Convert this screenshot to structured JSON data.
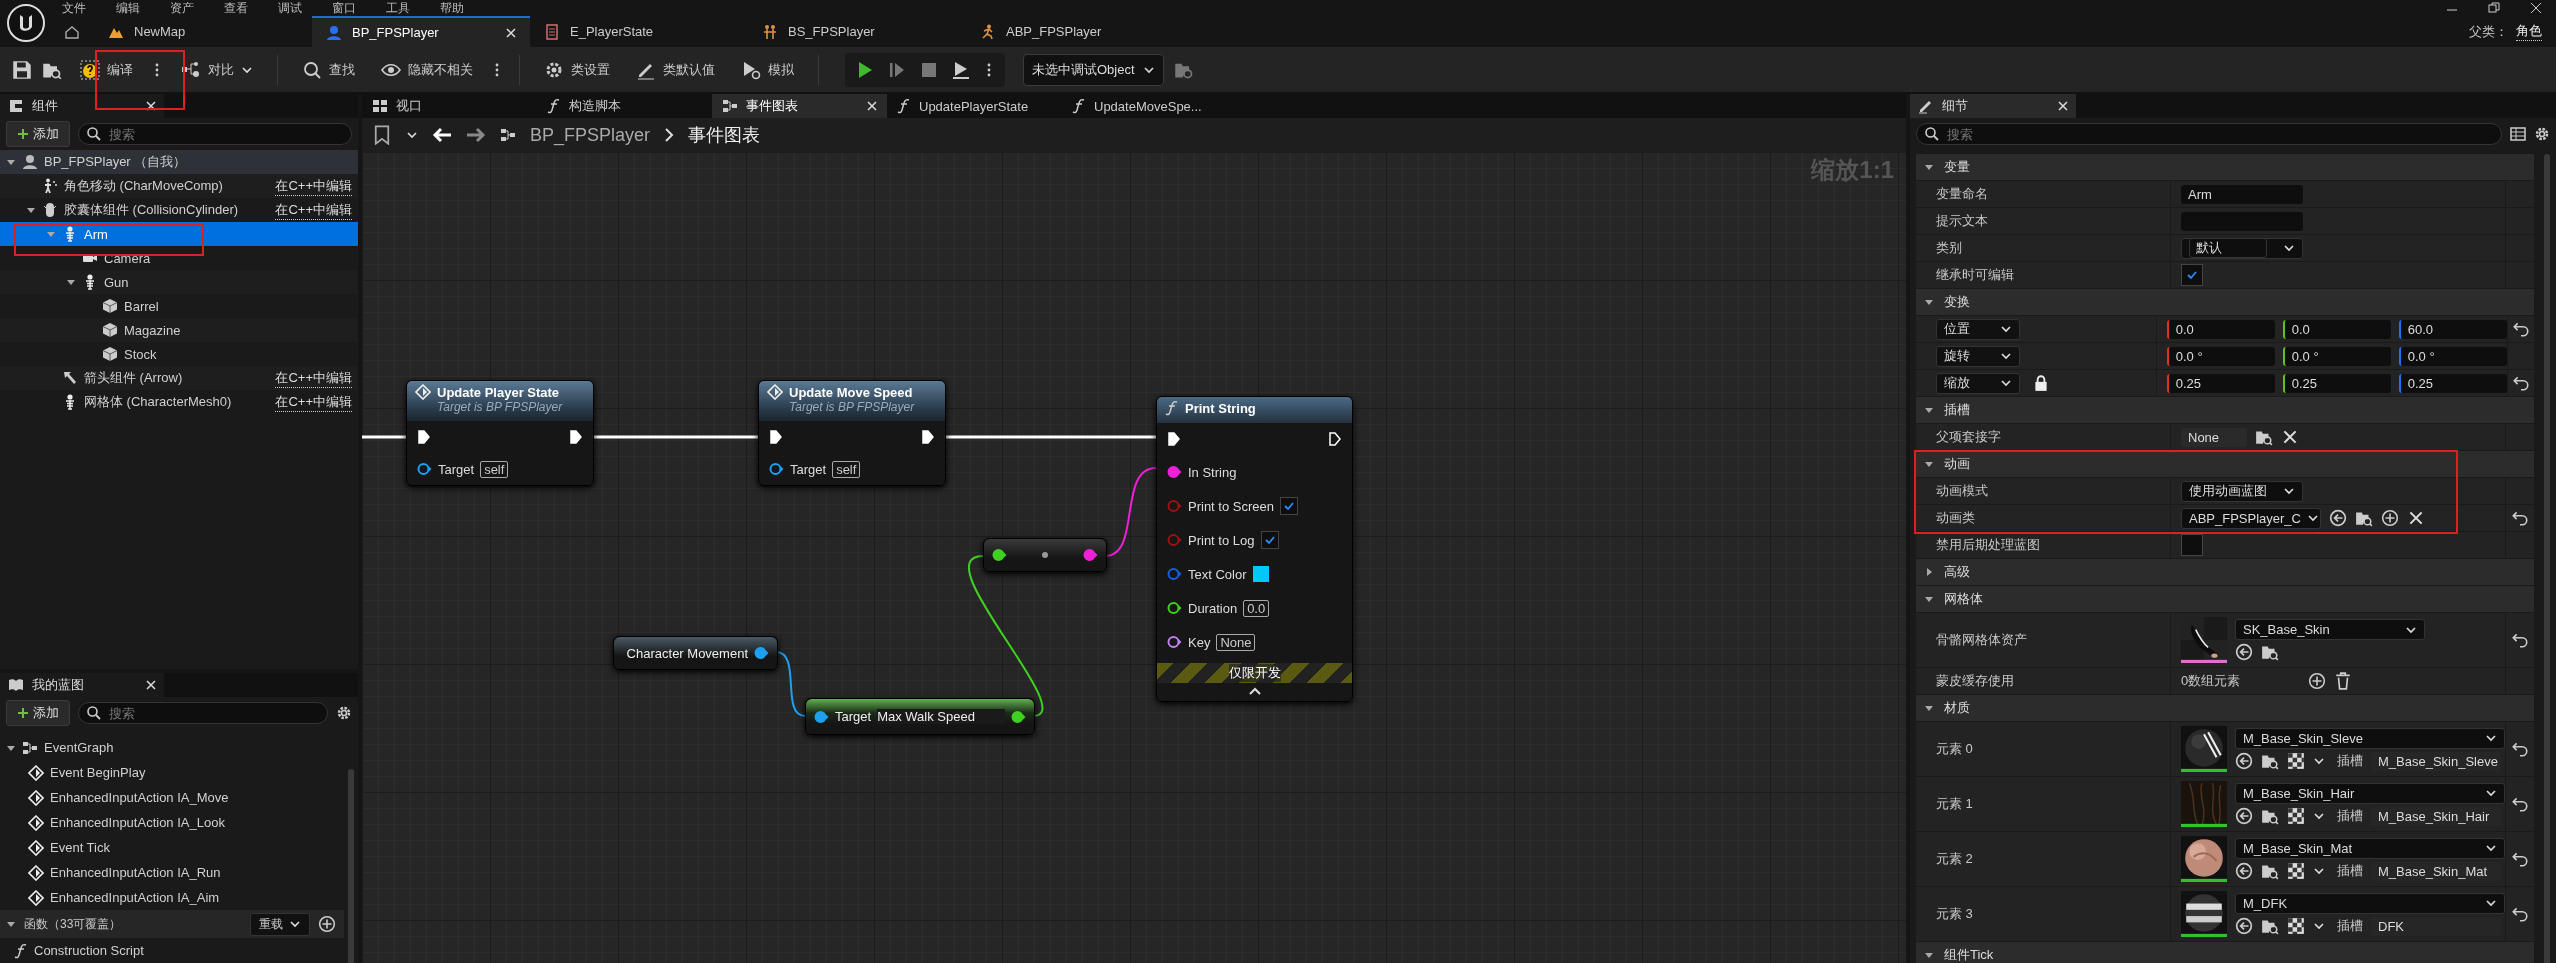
{
  "menu": [
    "文件",
    "编辑",
    "资产",
    "查看",
    "调试",
    "窗口",
    "工具",
    "帮助"
  ],
  "tabs": [
    {
      "kind": "level",
      "label": "NewMap",
      "selected": false
    },
    {
      "kind": "blueprint",
      "label": "BP_FPSPlayer",
      "selected": true
    },
    {
      "kind": "enum",
      "label": "E_PlayerState",
      "selected": false
    },
    {
      "kind": "blend_space",
      "label": "BS_FPSPlayer",
      "selected": false
    },
    {
      "kind": "anim_blueprint",
      "label": "ABP_FPSPlayer",
      "selected": false
    }
  ],
  "parent_class": {
    "label": "父类：",
    "value": "角色"
  },
  "toolbar": {
    "compile": "编译",
    "diff": "对比",
    "find": "查找",
    "hide": "隐藏不相关",
    "class_settings": "类设置",
    "class_defaults": "类默认值",
    "simulate": "模拟",
    "debug_object": "未选中调试Object"
  },
  "components": {
    "title": "组件",
    "add": "添加",
    "search_placeholder": "搜索",
    "tree": [
      {
        "kind": "actor",
        "label": "BP_FPSPlayer （自我）",
        "selected": false,
        "expanded": true,
        "children": [
          {
            "kind": "movement",
            "label": "角色移动 (CharMoveComp)",
            "link": "在C++中编辑",
            "selected": false
          },
          {
            "kind": "capsule",
            "label": "胶囊体组件 (CollisionCylinder)",
            "link": "在C++中编辑",
            "selected": false,
            "expanded": true,
            "children": [
              {
                "kind": "skeleton",
                "label": "Arm",
                "selected": true,
                "expanded": true,
                "children": [
                  {
                    "kind": "camera",
                    "label": "Camera",
                    "selected": false
                  },
                  {
                    "kind": "skeleton",
                    "label": "Gun",
                    "selected": false,
                    "expanded": true,
                    "children": [
                      {
                        "kind": "mesh",
                        "label": "Barrel",
                        "selected": false
                      },
                      {
                        "kind": "mesh",
                        "label": "Magazine",
                        "selected": false
                      },
                      {
                        "kind": "mesh",
                        "label": "Stock",
                        "selected": false
                      }
                    ]
                  }
                ]
              },
              {
                "kind": "arrow",
                "label": "箭头组件 (Arrow)",
                "link": "在C++中编辑",
                "selected": false
              },
              {
                "kind": "skeleton",
                "label": "网格体 (CharacterMesh0)",
                "link": "在C++中编辑",
                "selected": false
              }
            ]
          }
        ]
      }
    ]
  },
  "my_blueprint": {
    "title": "我的蓝图",
    "add": "添加",
    "search_placeholder": "搜索",
    "event_graph": {
      "label": "EventGraph",
      "expanded": true,
      "items": [
        "Event BeginPlay",
        "EnhancedInputAction IA_Move",
        "EnhancedInputAction IA_Look",
        "Event Tick",
        "EnhancedInputAction IA_Run",
        "EnhancedInputAction IA_Aim"
      ]
    },
    "functions": {
      "label": "函数（33可覆盖）",
      "expanded": true,
      "override": "重载",
      "items": [
        "Construction Script"
      ]
    }
  },
  "graph": {
    "tabs": [
      {
        "kind": "viewport",
        "label": "视口",
        "selected": false
      },
      {
        "kind": "function",
        "label": "构造脚本",
        "selected": false
      },
      {
        "kind": "graph",
        "label": "事件图表",
        "selected": true
      },
      {
        "kind": "function",
        "label": "UpdatePlayerState",
        "selected": false
      },
      {
        "kind": "function",
        "label": "UpdateMoveSpe...",
        "selected": false
      }
    ],
    "breadcrumb": [
      "BP_FPSPlayer",
      "事件图表"
    ],
    "zoom": "缩放1:1",
    "nodes": [
      {
        "kind": "function",
        "title": "Update Player State",
        "subtitle": "Target is BP FPSPlayer",
        "pins": [
          {
            "kind": "value",
            "color": "#1ea0f0",
            "label": "Target",
            "value": "self"
          }
        ]
      },
      {
        "kind": "function",
        "title": "Update Move Speed",
        "subtitle": "Target is BP FPSPlayer",
        "pins": [
          {
            "kind": "value",
            "color": "#1ea0f0",
            "label": "Target",
            "value": "self"
          }
        ]
      },
      {
        "kind": "print",
        "title": "Print String",
        "footer": "仅限开发",
        "pins": [
          {
            "kind": "plain",
            "color": "#f020d8",
            "label": "In String"
          },
          {
            "kind": "bool",
            "color": "#a01010",
            "label": "Print to Screen",
            "checked": true
          },
          {
            "kind": "bool",
            "color": "#a01010",
            "label": "Print to Log",
            "checked": true
          },
          {
            "kind": "swatch",
            "color": "#1060e0",
            "label": "Text Color",
            "swatch": {
              "color": "#00c8f8"
            }
          },
          {
            "kind": "value",
            "color": "#40d020",
            "label": "Duration",
            "value": "0.0"
          },
          {
            "kind": "value",
            "color": "#c080f0",
            "label": "Key",
            "value": "None"
          }
        ]
      },
      {
        "kind": "convert",
        "input": {
          "color": "#40d020"
        },
        "output": {
          "color": "#f020d8"
        }
      },
      {
        "kind": "variable",
        "title": "Character Movement",
        "output": {
          "color": "#1ea0f0"
        }
      },
      {
        "kind": "getter",
        "input": {
          "color": "#1ea0f0",
          "label": "Target"
        },
        "output": {
          "color": "#40d020",
          "label": "Max Walk Speed"
        }
      }
    ]
  },
  "details": {
    "title": "细节",
    "search_placeholder": "搜索",
    "sections": [
      {
        "title": "变量",
        "expanded": true,
        "rows": [
          {
            "kind": "text",
            "label": "变量命名",
            "value": "Arm"
          },
          {
            "kind": "text",
            "label": "提示文本"
          },
          {
            "kind": "combo",
            "label": "类别",
            "value": "默认"
          },
          {
            "kind": "checkbox",
            "label": "继承时可编辑",
            "checked": true
          }
        ]
      },
      {
        "title": "变换",
        "expanded": true,
        "rows": [
          {
            "kind": "vector",
            "label": "位置",
            "values": [
              "0.0",
              "0.0",
              "60.0"
            ],
            "reset": true,
            "locked": false
          },
          {
            "kind": "vector",
            "label": "旋转",
            "values": [
              "0.0 °",
              "0.0 °",
              "0.0 °"
            ],
            "reset": false,
            "locked": false
          },
          {
            "kind": "vector",
            "label": "缩放",
            "values": [
              "0.25",
              "0.25",
              "0.25"
            ],
            "reset": true,
            "locked": true
          }
        ]
      },
      {
        "title": "插槽",
        "expanded": true,
        "rows": [
          {
            "kind": "socket",
            "label": "父项套接字",
            "value": "None"
          }
        ]
      },
      {
        "title": "动画",
        "expanded": true,
        "rows": [
          {
            "kind": "dropdown",
            "label": "动画模式",
            "value": "使用动画蓝图"
          },
          {
            "kind": "class",
            "label": "动画类",
            "value": "ABP_FPSPlayer_C",
            "reset": true
          },
          {
            "kind": "checkbox",
            "label": "禁用后期处理蓝图",
            "checked": false
          }
        ]
      },
      {
        "title": "高级",
        "expanded": false
      },
      {
        "title": "网格体",
        "expanded": true,
        "rows": [
          {
            "kind": "asset",
            "label": "骨骼网格体资产",
            "value": "SK_Base_Skin",
            "reset": true
          },
          {
            "kind": "array",
            "label": "蒙皮缓存使用",
            "value": "0数组元素"
          }
        ]
      },
      {
        "title": "材质",
        "expanded": true,
        "rows": [
          {
            "kind": "material",
            "label": "元素 0",
            "value": "M_Base_Skin_Sleve",
            "slot_label": "插槽",
            "slot": "M_Base_Skin_Sleve",
            "reset": true
          },
          {
            "kind": "material",
            "label": "元素 1",
            "value": "M_Base_Skin_Hair",
            "slot_label": "插槽",
            "slot": "M_Base_Skin_Hair",
            "reset": true
          },
          {
            "kind": "material",
            "label": "元素 2",
            "value": "M_Base_Skin_Mat",
            "slot_label": "插槽",
            "slot": "M_Base_Skin_Mat",
            "reset": true
          },
          {
            "kind": "material",
            "label": "元素 3",
            "value": "M_DFK",
            "slot_label": "插槽",
            "slot": "DFK",
            "reset": true
          }
        ]
      },
      {
        "title": "组件Tick",
        "expanded": true
      }
    ]
  }
}
